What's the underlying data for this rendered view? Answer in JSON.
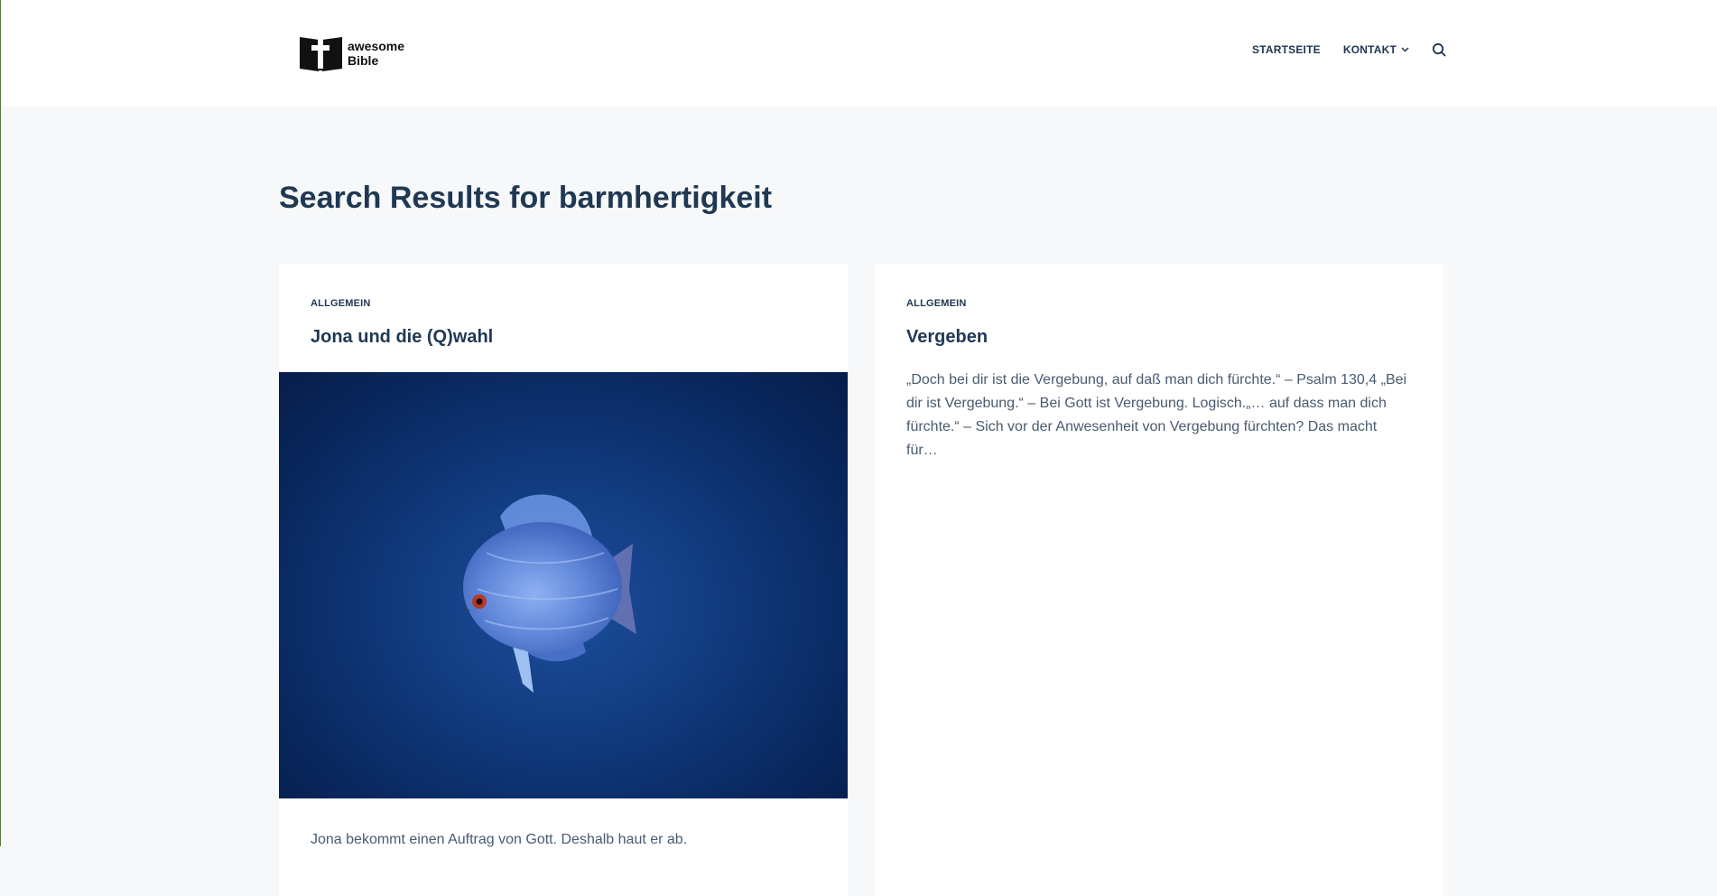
{
  "brand": {
    "line1": "awesome",
    "line2": "Bible"
  },
  "nav": {
    "items": [
      {
        "label": "STARTSEITE"
      },
      {
        "label": "KONTAKT"
      }
    ]
  },
  "page": {
    "title": "Search Results for barmhertigkeit"
  },
  "posts": [
    {
      "category": "ALLGEMEIN",
      "title": "Jona und die (Q)wahl",
      "excerpt": "Jona bekommt einen Auftrag von Gott. Deshalb haut er ab."
    },
    {
      "category": "ALLGEMEIN",
      "title": "Vergeben",
      "excerpt": "„Doch bei dir ist die Vergebung, auf daß man dich fürchte.“ – Psalm 130,4 „Bei dir ist Vergebung.“ – Bei Gott ist Vergebung. Logisch.„… auf dass man dich fürchte.“ – Sich vor der Anwesenheit von Vergebung fürchten? Das macht für…"
    }
  ],
  "colors": {
    "text": "#1e3551",
    "background": "#f7f8f9",
    "card": "#ffffff"
  }
}
